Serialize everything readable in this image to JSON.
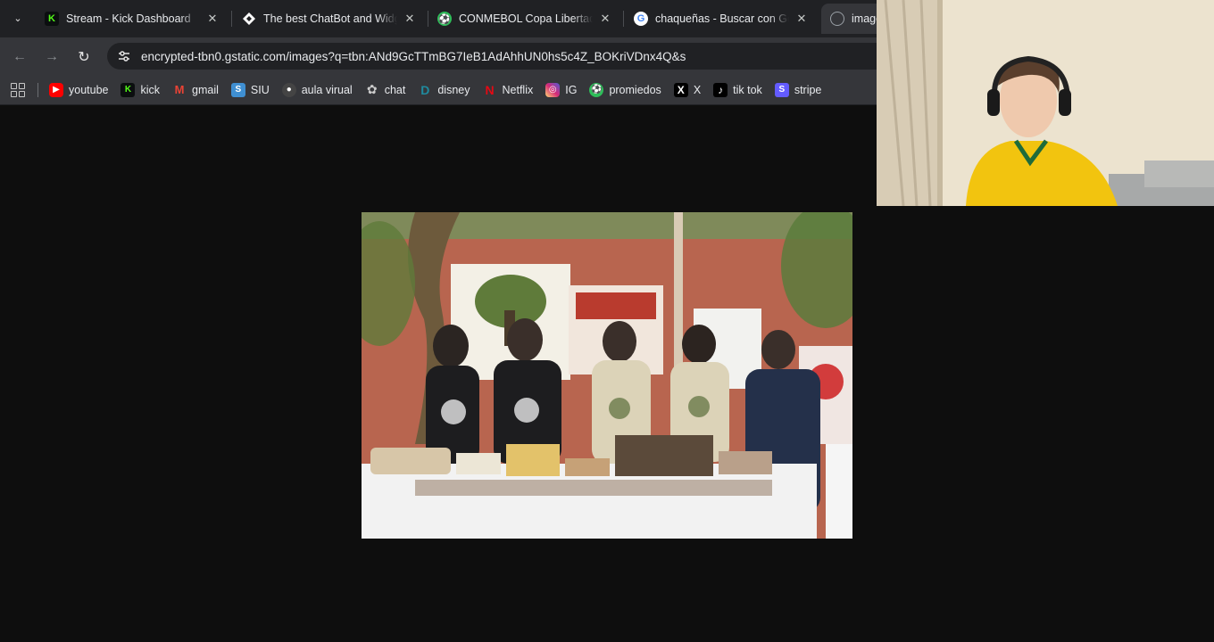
{
  "tabs": [
    {
      "title": "Stream - Kick Dashboard",
      "icon": "kick-icon",
      "color": "#53fc18"
    },
    {
      "title": "The best ChatBot and Widgets",
      "icon": "botrix-icon",
      "color": "#ffffff"
    },
    {
      "title": "CONMEBOL Copa Libertadores",
      "icon": "conmebol-icon",
      "color": "#2ebd59"
    },
    {
      "title": "chaqueñas - Buscar con Google",
      "icon": "google-icon",
      "color": "#4285f4"
    },
    {
      "title": "image",
      "icon": "globe-icon",
      "color": "#9aa0a6"
    }
  ],
  "toolbar": {
    "url": "encrypted-tbn0.gstatic.com/images?q=tbn:ANd9GcTTmBG7IeB1AdAhhUN0hs5c4Z_BOKriVDnx4Q&s"
  },
  "bookmarks": [
    {
      "label": "youtube",
      "icon": "youtube-icon",
      "color": "#ff0000"
    },
    {
      "label": "kick",
      "icon": "kick-icon",
      "color": "#53fc18"
    },
    {
      "label": "gmail",
      "icon": "gmail-icon",
      "color": "#ea4335"
    },
    {
      "label": "SIU",
      "icon": "siu-icon",
      "color": "#3f8fd2"
    },
    {
      "label": "aula virual",
      "icon": "aula-icon",
      "color": "#444444"
    },
    {
      "label": "chat",
      "icon": "openai-icon",
      "color": "#cccccc"
    },
    {
      "label": "disney",
      "icon": "disney-icon",
      "color": "#1f8a9e"
    },
    {
      "label": "Netflix",
      "icon": "netflix-icon",
      "color": "#e50914"
    },
    {
      "label": "IG",
      "icon": "instagram-icon",
      "color": "#d62976"
    },
    {
      "label": "promiedos",
      "icon": "promiedos-icon",
      "color": "#2ebd59"
    },
    {
      "label": "X",
      "icon": "x-icon",
      "color": "#000000"
    },
    {
      "label": "tik tok",
      "icon": "tiktok-icon",
      "color": "#000000"
    },
    {
      "label": "stripe",
      "icon": "stripe-icon",
      "color": "#635bff"
    }
  ]
}
